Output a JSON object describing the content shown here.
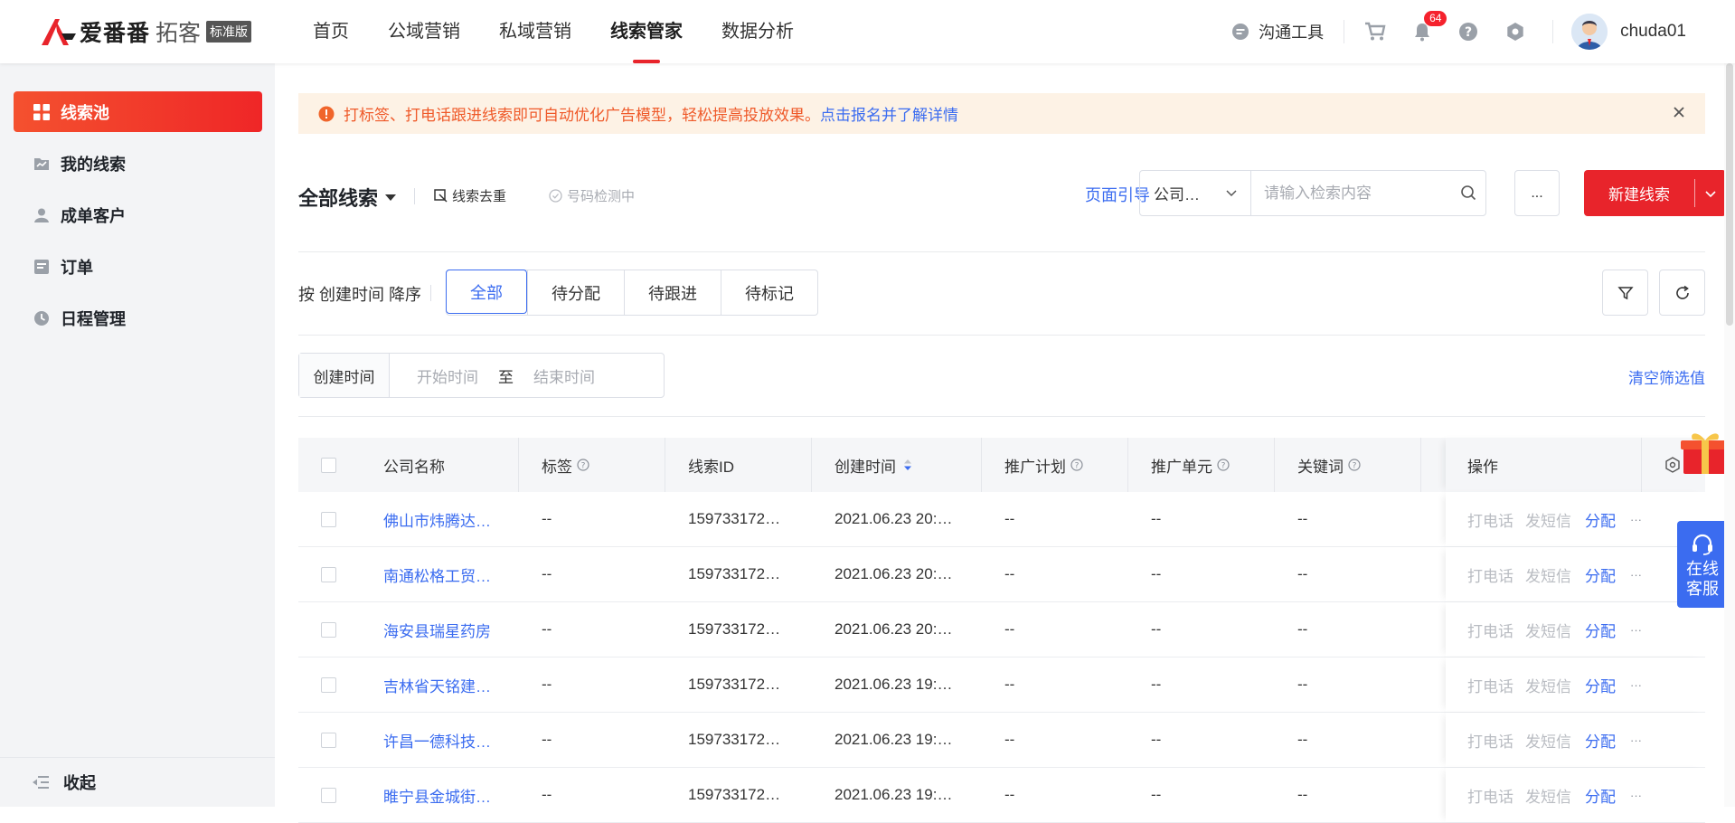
{
  "brand": {
    "name": "爱番番",
    "product": "拓客",
    "edition": "标准版"
  },
  "nav": [
    {
      "label": "首页"
    },
    {
      "label": "公域营销"
    },
    {
      "label": "私域营销"
    },
    {
      "label": "线索管家"
    },
    {
      "label": "数据分析"
    }
  ],
  "topbar": {
    "comm_tool": "沟通工具",
    "notifications": "64",
    "username": "chuda01"
  },
  "sidebar": {
    "items": [
      {
        "label": "线索池",
        "icon": "grid-icon"
      },
      {
        "label": "我的线索",
        "icon": "folder-icon"
      },
      {
        "label": "成单客户",
        "icon": "user-icon"
      },
      {
        "label": "订单",
        "icon": "order-icon"
      },
      {
        "label": "日程管理",
        "icon": "clock-icon"
      }
    ],
    "collapse": "收起"
  },
  "notice": {
    "text": "打标签、打电话跟进线索即可自动优化广告模型，轻松提高投放效果。",
    "link": "点击报名并了解详情"
  },
  "header": {
    "title": "全部线索",
    "dedupe": "线索去重",
    "number_check": "号码检测中",
    "guide": "页面引导",
    "search_field": "公司…",
    "search_placeholder": "请输入检索内容",
    "more": "...",
    "new_button": "新建线索"
  },
  "filters": {
    "sort_label": "按 创建时间 降序",
    "tabs": [
      "全部",
      "待分配",
      "待跟进",
      "待标记"
    ],
    "date_label": "创建时间",
    "start_placeholder": "开始时间",
    "to": "至",
    "end_placeholder": "结束时间",
    "clear": "清空筛选值"
  },
  "table": {
    "columns": [
      "公司名称",
      "标签",
      "线索ID",
      "创建时间",
      "推广计划",
      "推广单元",
      "关键词",
      "操作"
    ],
    "rows": [
      {
        "company": "佛山市炜腾达…",
        "tag": "--",
        "id": "159733172…",
        "time": "2021.06.23 20:…",
        "plan": "--",
        "unit": "--",
        "keyword": "--"
      },
      {
        "company": "南通松格工贸…",
        "tag": "--",
        "id": "159733172…",
        "time": "2021.06.23 20:…",
        "plan": "--",
        "unit": "--",
        "keyword": "--"
      },
      {
        "company": "海安县瑞星药房",
        "tag": "--",
        "id": "159733172…",
        "time": "2021.06.23 20:…",
        "plan": "--",
        "unit": "--",
        "keyword": "--"
      },
      {
        "company": "吉林省天铭建…",
        "tag": "--",
        "id": "159733172…",
        "time": "2021.06.23 19:…",
        "plan": "--",
        "unit": "--",
        "keyword": "--"
      },
      {
        "company": "许昌一德科技…",
        "tag": "--",
        "id": "159733172…",
        "time": "2021.06.23 19:…",
        "plan": "--",
        "unit": "--",
        "keyword": "--"
      },
      {
        "company": "睢宁县金城街…",
        "tag": "--",
        "id": "159733172…",
        "time": "2021.06.23 19:…",
        "plan": "--",
        "unit": "--",
        "keyword": "--"
      }
    ],
    "actions": {
      "call": "打电话",
      "sms": "发短信",
      "assign": "分配",
      "more": "···"
    }
  },
  "float": {
    "service_line1": "在线",
    "service_line2": "客服"
  },
  "colors": {
    "accent": "#e8242b",
    "link": "#3b6cf0",
    "notice_bg": "#fdf2e5",
    "notice_text": "#ef5a2a"
  }
}
